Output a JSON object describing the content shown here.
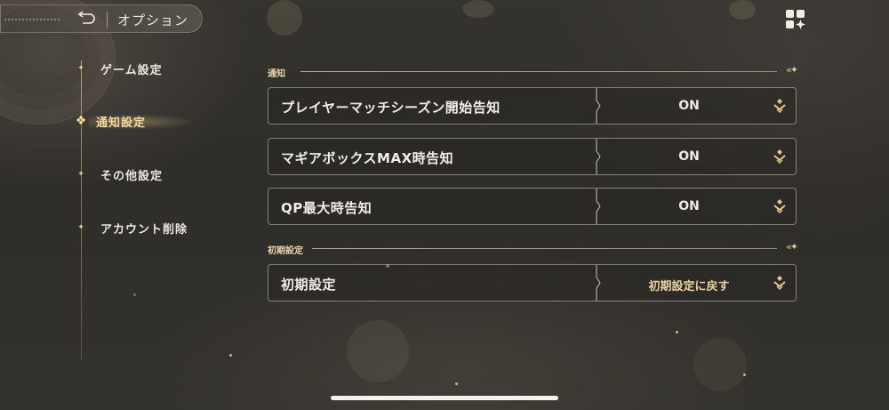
{
  "header": {
    "back_icon": "back-arrow-icon",
    "title": "オプション"
  },
  "top_right_icon": "menu-grid-icon",
  "sidebar": {
    "items": [
      {
        "label": "ゲーム設定",
        "active": false
      },
      {
        "label": "通知設定",
        "active": true
      },
      {
        "label": "その他設定",
        "active": false
      },
      {
        "label": "アカウント削除",
        "active": false
      }
    ]
  },
  "sections": {
    "notify": {
      "title": "通知",
      "rows": [
        {
          "label": "プレイヤーマッチシーズン開始告知",
          "value": "ON"
        },
        {
          "label": "マギアボックスMAX時告知",
          "value": "ON"
        },
        {
          "label": "QP最大時告知",
          "value": "ON"
        }
      ]
    },
    "reset": {
      "title": "初期設定",
      "rows": [
        {
          "label": "初期設定",
          "value": "初期設定に戻す"
        }
      ]
    }
  },
  "colors": {
    "accent_gold": "#e8d29c",
    "background": "#312f2c",
    "border": "#d2c8b4"
  }
}
